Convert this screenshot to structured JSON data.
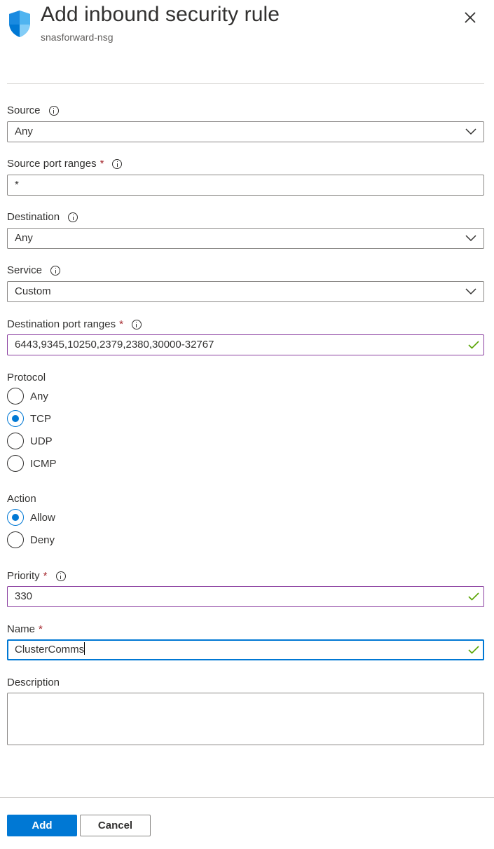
{
  "header": {
    "title": "Add inbound security rule",
    "subtitle": "snasforward-nsg"
  },
  "form": {
    "source": {
      "label": "Source",
      "value": "Any"
    },
    "source_port_ranges": {
      "label": "Source port ranges",
      "required": "*",
      "value": "*"
    },
    "destination": {
      "label": "Destination",
      "value": "Any"
    },
    "service": {
      "label": "Service",
      "value": "Custom"
    },
    "destination_port_ranges": {
      "label": "Destination port ranges",
      "required": "*",
      "value": "6443,9345,10250,2379,2380,30000-32767"
    },
    "protocol": {
      "label": "Protocol",
      "options": [
        "Any",
        "TCP",
        "UDP",
        "ICMP"
      ],
      "selected": "TCP"
    },
    "action": {
      "label": "Action",
      "options": [
        "Allow",
        "Deny"
      ],
      "selected": "Allow"
    },
    "priority": {
      "label": "Priority",
      "required": "*",
      "value": "330"
    },
    "name": {
      "label": "Name",
      "required": "*",
      "value": "ClusterComms"
    },
    "description": {
      "label": "Description",
      "value": ""
    }
  },
  "footer": {
    "add_label": "Add",
    "cancel_label": "Cancel"
  },
  "colors": {
    "accent": "#0078d4",
    "required": "#a4262c",
    "valid_check": "#57a300",
    "valid_border": "#8a3fa0"
  }
}
